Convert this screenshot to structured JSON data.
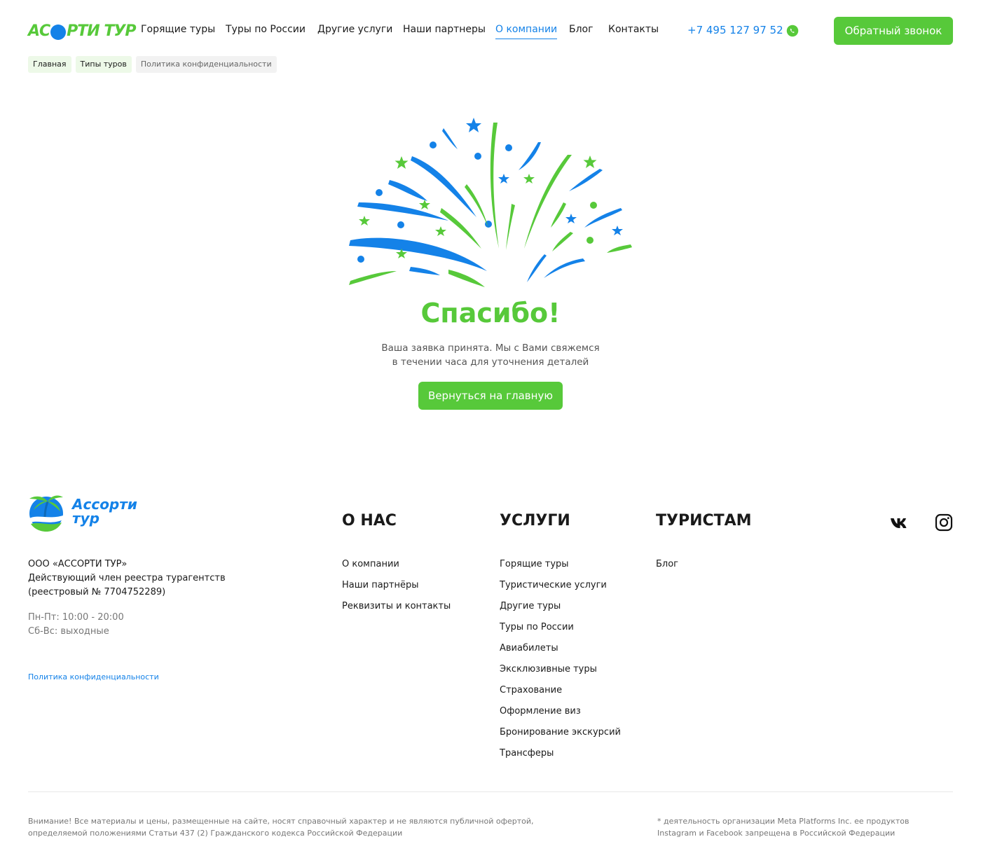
{
  "header": {
    "logo_text_left": "АС",
    "logo_text_right": "РТИ ТУР",
    "nav": [
      {
        "label": "Горящие туры"
      },
      {
        "label": "Туры по России"
      },
      {
        "label": "Другие услуги"
      },
      {
        "label": "Наши партнеры"
      },
      {
        "label": "О компании"
      },
      {
        "label": "Блог"
      },
      {
        "label": "Контакты"
      }
    ],
    "active_nav": "О компании",
    "phone": "+7 495 127 97 52",
    "callback_label": "Обратный звонок"
  },
  "breadcrumb": [
    {
      "label": "Главная"
    },
    {
      "label": "Типы туров"
    },
    {
      "label": "Политика конфиденциальности"
    }
  ],
  "thanks": {
    "title": "Спасибо!",
    "text": "Ваша заявка принята. Мы с Вами свяжемся в течении часа для уточнения деталей",
    "button": "Вернуться на главную"
  },
  "footer": {
    "brand_line1": "Ассорти",
    "brand_line2": "тур",
    "company_lines": [
      "ООО «АССОРТИ ТУР»",
      "Действующий член реестра турагентств",
      "(реестровый № 7704752289)"
    ],
    "hours": [
      "Пн-Пт: 10:00 - 20:00",
      "Сб-Вс: выходные"
    ],
    "privacy_link": "Политика конфиденциальности",
    "columns": [
      {
        "title": "О НАС",
        "items": [
          "О компании",
          "Наши партнёры",
          "Реквизиты и контакты"
        ]
      },
      {
        "title": "УСЛУГИ",
        "items": [
          "Горящие туры",
          "Туристические услуги",
          "Другие туры",
          "Туры по России",
          "Авиабилеты",
          "Эксклюзивные туры",
          "Страхование",
          "Оформление виз",
          "Бронирование экскурсий",
          "Трансферы"
        ]
      },
      {
        "title": "ТУРИСТАМ",
        "items": [
          "Блог"
        ]
      }
    ],
    "social": [
      "vk-icon",
      "instagram-icon"
    ],
    "disclaimer_lines": [
      "Внимание! Все материалы и цены, размещенные на сайте, носят справочный характер и не являются публичной офертой,",
      "определяемой положениями Статьи 437 (2) Гражданского кодекса Российской Федерации"
    ],
    "meta_note_lines": [
      "* деятельность организации Meta Platforms Inc. ее продуктов",
      "Instagram и Facebook запрещена в Российской Федерации"
    ]
  },
  "colors": {
    "green": "#57c93a",
    "blue": "#1482e8"
  }
}
